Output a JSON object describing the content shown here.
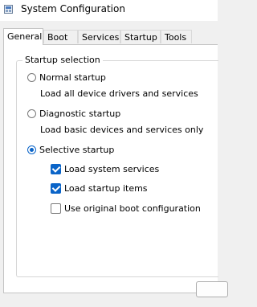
{
  "window": {
    "title": "System Configuration",
    "icon": "system-config-icon"
  },
  "tabs": [
    {
      "label": "General",
      "active": true
    },
    {
      "label": "Boot",
      "active": false
    },
    {
      "label": "Services",
      "active": false
    },
    {
      "label": "Startup",
      "active": false
    },
    {
      "label": "Tools",
      "active": false
    }
  ],
  "startup_selection": {
    "legend": "Startup selection",
    "normal": {
      "label": "Normal startup",
      "description": "Load all device drivers and services",
      "checked": false
    },
    "diagnostic": {
      "label": "Diagnostic startup",
      "description": "Load basic devices and services only",
      "checked": false
    },
    "selective": {
      "label": "Selective startup",
      "checked": true
    },
    "options": [
      {
        "label": "Load system services",
        "checked": true
      },
      {
        "label": "Load startup items",
        "checked": true
      },
      {
        "label": "Use original boot configuration",
        "checked": false
      }
    ]
  },
  "colors": {
    "accent": "#0a64c8",
    "window_bg": "#f0f0f0",
    "panel_bg": "#ffffff"
  }
}
